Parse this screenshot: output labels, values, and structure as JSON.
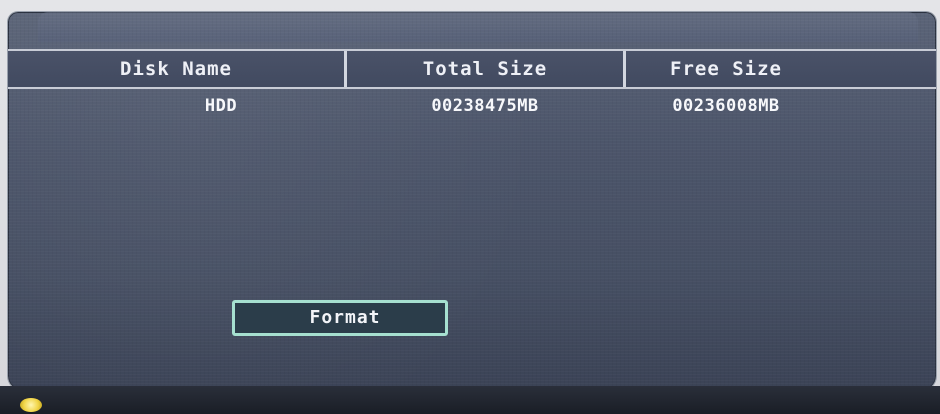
{
  "disk_table": {
    "columns": [
      "Disk Name",
      "Total Size",
      "Free Size"
    ],
    "rows": [
      {
        "disk_name": "HDD",
        "total_size": "00238475MB",
        "free_size": "00236008MB"
      }
    ]
  },
  "actions": {
    "format_label": "Format"
  },
  "colors": {
    "panel": "#4c556a",
    "header_border": "#c8ccd6",
    "button_border": "#a6e0d0",
    "power_led": "#f1d548"
  },
  "icons": {
    "power_led": "power-led-icon"
  }
}
